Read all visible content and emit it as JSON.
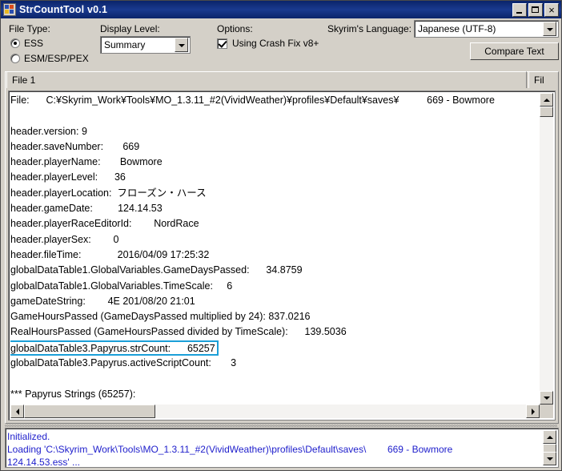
{
  "window": {
    "title": "StrCountTool v0.1",
    "icon": "app-icon",
    "minimize_label": "Minimize",
    "maximize_label": "Maximize",
    "close_label": "Close"
  },
  "toolbar": {
    "file_type_label": "File Type:",
    "file_type_options": [
      {
        "label": "ESS",
        "selected": true
      },
      {
        "label": "ESM/ESP/PEX",
        "selected": false
      }
    ],
    "display_level_label": "Display Level:",
    "display_level_value": "Summary",
    "options_label": "Options:",
    "crash_fix_label": "Using Crash Fix v8+",
    "crash_fix_checked": true,
    "language_label": "Skyrim's Language:",
    "language_value": "Japanese (UTF-8)",
    "compare_text_label": "Compare Text"
  },
  "tabs": [
    {
      "label": "File 1",
      "active": true
    },
    {
      "label": "Fil",
      "active": false
    }
  ],
  "report": {
    "lines": [
      "File:      C:¥Skyrim_Work¥Tools¥MO_1.3.11_#2(VividWeather)¥profiles¥Default¥saves¥          669 - Bowmore",
      "",
      "header.version: 9",
      "header.saveNumber:       669",
      "header.playerName:       Bowmore",
      "header.playerLevel:      36",
      "header.playerLocation:  フローズン・ハース",
      "header.gameDate:         124.14.53",
      "header.playerRaceEditorId:        NordRace",
      "header.playerSex:        0",
      "header.fileTime:             2016/04/09 17:25:32",
      "globalDataTable1.GlobalVariables.GameDaysPassed:      34.8759",
      "globalDataTable1.GlobalVariables.TimeScale:     6",
      "gameDateString:        4E 201/08/20 21:01",
      "GameHoursPassed (GameDaysPassed multiplied by 24): 837.0216",
      "RealHoursPassed (GameHoursPassed divided by TimeScale):      139.5036"
    ],
    "highlighted_line": "globalDataTable3.Papyrus.strCount:      65257",
    "highlight_color": "#1b9fd8",
    "lines_after": [
      "globalDataTable3.Papyrus.activeScriptCount:       3",
      "",
      "*** Papyrus Strings (65257):"
    ]
  },
  "log": {
    "lines": [
      "Initialized.",
      "Loading 'C:\\Skyrim_Work\\Tools\\MO_1.3.11_#2(VividWeather)\\profiles\\Default\\saves\\        669 - Bowmore",
      "124.14.53.ess' ..."
    ],
    "text_color": "#2020cc"
  }
}
